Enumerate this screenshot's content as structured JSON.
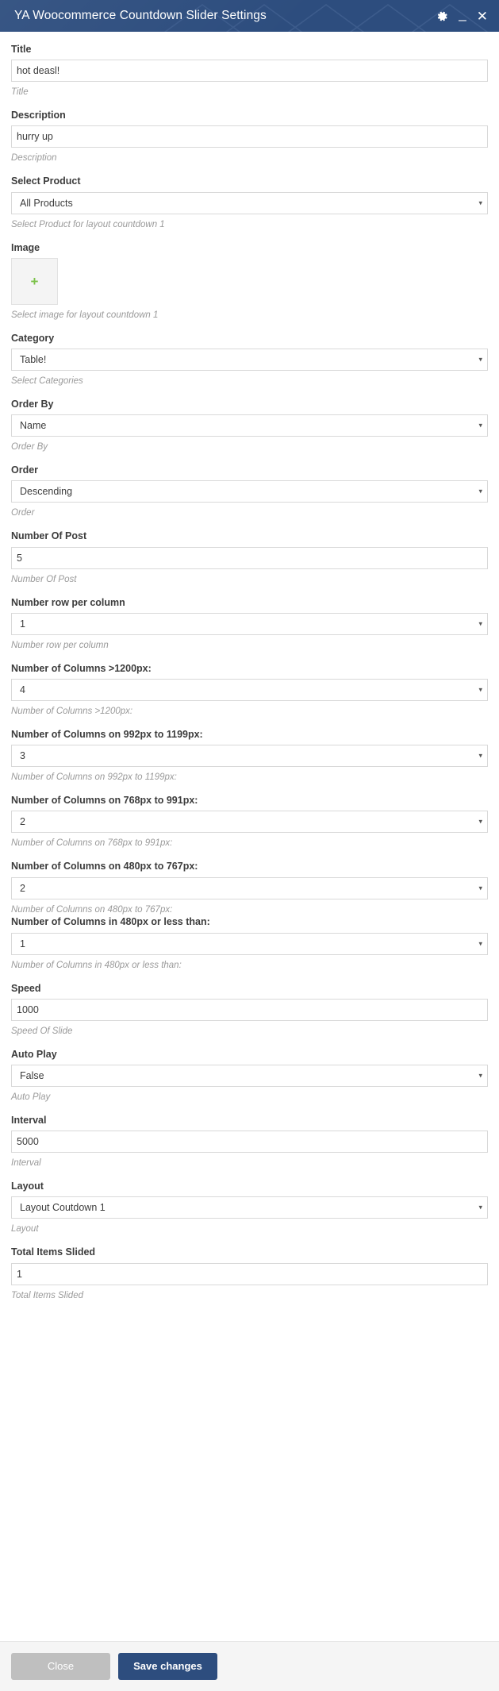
{
  "titlebar": {
    "title": "YA Woocommerce Countdown Slider Settings",
    "gear_icon": "gear-icon",
    "minimize_icon": "minimize-icon",
    "close_icon": "close-icon",
    "bg_color": "#2d4d7e"
  },
  "form": {
    "fields": [
      {
        "label": "Title",
        "type": "text",
        "value": "hot deasl!",
        "help": "Title"
      },
      {
        "label": "Description",
        "type": "text",
        "value": "hurry up",
        "help": "Description"
      },
      {
        "label": "Select Product",
        "type": "select",
        "value": "All Products",
        "help": "Select Product for layout countdown 1"
      },
      {
        "label": "Image",
        "type": "image",
        "value": "+",
        "help": "Select image for layout countdown 1"
      },
      {
        "label": "Category",
        "type": "select",
        "value": "Table!",
        "help": "Select Categories"
      },
      {
        "label": "Order By",
        "type": "select",
        "value": "Name",
        "help": "Order By"
      },
      {
        "label": "Order",
        "type": "select",
        "value": "Descending",
        "help": "Order"
      },
      {
        "label": "Number Of Post",
        "type": "text",
        "value": "5",
        "help": "Number Of Post"
      },
      {
        "label": "Number row per column",
        "type": "select",
        "value": "1",
        "help": "Number row per column"
      },
      {
        "label": "Number of Columns >1200px:",
        "type": "select",
        "value": "4",
        "help": "Number of Columns >1200px:"
      },
      {
        "label": "Number of Columns on 992px to 1199px:",
        "type": "select",
        "value": "3",
        "help": "Number of Columns on 992px to 1199px:"
      },
      {
        "label": "Number of Columns on 768px to 991px:",
        "type": "select",
        "value": "2",
        "help": "Number of Columns on 768px to 991px:"
      },
      {
        "label": "Number of Columns on 480px to 767px:",
        "type": "select",
        "value": "2",
        "help": "Number of Columns on 480px to 767px:"
      },
      {
        "label": "Number of Columns in 480px or less than:",
        "type": "select",
        "value": "1",
        "help": "Number of Columns in 480px or less than:"
      },
      {
        "label": "Speed",
        "type": "text",
        "value": "1000",
        "help": "Speed Of Slide"
      },
      {
        "label": "Auto Play",
        "type": "select",
        "value": "False",
        "help": "Auto Play"
      },
      {
        "label": "Interval",
        "type": "text",
        "value": "5000",
        "help": "Interval"
      },
      {
        "label": "Layout",
        "type": "select",
        "value": "Layout Coutdown 1",
        "help": "Layout"
      },
      {
        "label": "Total Items Slided",
        "type": "text",
        "value": "1",
        "help": "Total Items Slided"
      }
    ],
    "dropdown_arrow": "▾"
  },
  "footer": {
    "close_label": "Close",
    "save_label": "Save changes",
    "close_color": "#bfbfbf",
    "save_color": "#2d4d7e"
  }
}
